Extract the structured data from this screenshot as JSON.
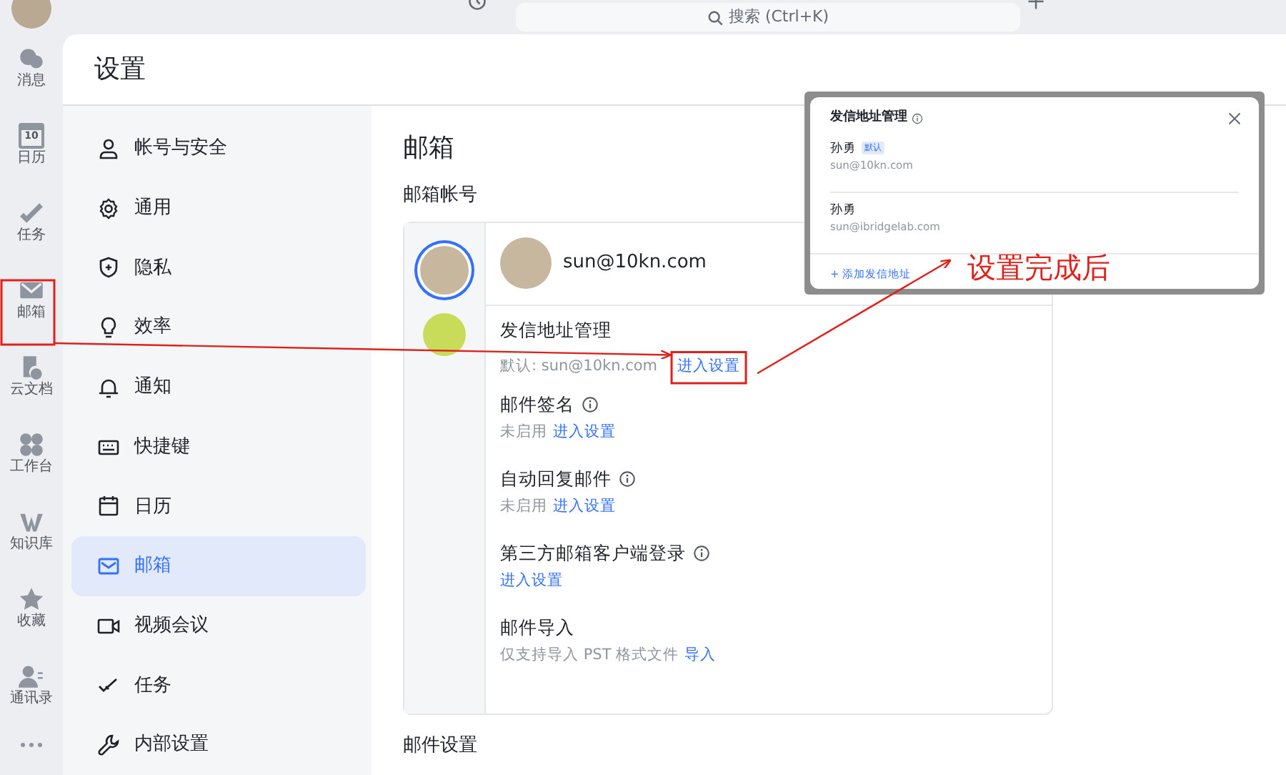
{
  "top_bar": {
    "search_placeholder": "搜索 (Ctrl+K)"
  },
  "rail": [
    {
      "label": "消息"
    },
    {
      "label": "日历",
      "date": "10"
    },
    {
      "label": "任务"
    },
    {
      "label": "邮箱"
    },
    {
      "label": "云文档"
    },
    {
      "label": "工作台"
    },
    {
      "label": "知识库"
    },
    {
      "label": "收藏"
    },
    {
      "label": "通讯录"
    }
  ],
  "settings": {
    "title": "设置",
    "nav": [
      {
        "label": "帐号与安全",
        "selected": false
      },
      {
        "label": "通用",
        "selected": false
      },
      {
        "label": "隐私",
        "selected": false
      },
      {
        "label": "效率",
        "selected": false
      },
      {
        "label": "通知",
        "selected": false
      },
      {
        "label": "快捷键",
        "selected": false
      },
      {
        "label": "日历",
        "selected": false
      },
      {
        "label": "邮箱",
        "selected": true
      },
      {
        "label": "视频会议",
        "selected": false
      },
      {
        "label": "任务",
        "selected": false
      },
      {
        "label": "内部设置",
        "selected": false
      }
    ],
    "page_title": "邮箱",
    "section": "邮箱帐号",
    "account_email": "sun@10kn.com",
    "accounts": [
      {
        "kind": "photo",
        "selected": true
      },
      {
        "kind": "letter",
        "selected": false
      }
    ],
    "options": [
      {
        "title": "发信地址管理",
        "info": false,
        "note": "默认: sun@10kn.com",
        "link": "进入设置"
      },
      {
        "title": "邮件签名",
        "info": true,
        "note": "未启用",
        "link": "进入设置"
      },
      {
        "title": "自动回复邮件",
        "info": true,
        "note": "未启用",
        "link": "进入设置"
      },
      {
        "title": "第三方邮箱客户端登录",
        "info": true,
        "link": "进入设置"
      },
      {
        "title": "邮件导入",
        "info": false,
        "note": "仅支持导入 PST 格式文件",
        "link": "导入"
      }
    ],
    "next_section": "邮件设置"
  },
  "popup": {
    "title": "发信地址管理",
    "senders": [
      {
        "name": "孙勇",
        "tag": "默认",
        "email": "sun@10kn.com"
      },
      {
        "name": "孙勇",
        "email": "sun@ibridgelab.com"
      }
    ],
    "add_link": "+ 添加发信地址"
  },
  "annotation": {
    "text": "设置完成后"
  }
}
